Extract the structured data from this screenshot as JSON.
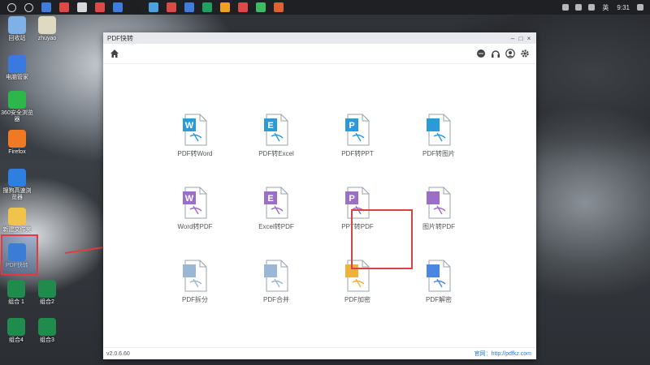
{
  "taskbar": {
    "time": "9:31",
    "ime": "英",
    "icons": [
      "search-icon",
      "task-view-icon",
      "browser-icon",
      "app-icon",
      "app-icon",
      "app-icon",
      "app-icon",
      "app-icon",
      "app-icon",
      "app-icon",
      "app-icon",
      "app-icon",
      "app-icon",
      "app-icon",
      "app-icon",
      "app-icon"
    ]
  },
  "desktop": {
    "icons": [
      {
        "label": "回收站",
        "color": "#7fb0e6"
      },
      {
        "label": "zhuyao",
        "color": "#e0d9c1"
      },
      {
        "label": "电脑管家",
        "color": "#3a7ae0"
      },
      {
        "label": "360安全浏览器",
        "color": "#2db64a"
      },
      {
        "label": "Firefox",
        "color": "#f07a24"
      },
      {
        "label": "搜狗高速浏览器",
        "color": "#2f7fe0"
      },
      {
        "label": "新建文件夹",
        "color": "#f0c34b"
      },
      {
        "label": "PDF快转",
        "color": "#3b86e8"
      },
      {
        "label": "组合 1",
        "color": "#1f8b4c"
      },
      {
        "label": "组合2",
        "color": "#1f8b4c"
      },
      {
        "label": "组合4",
        "color": "#1f8b4c"
      },
      {
        "label": "组合3",
        "color": "#1f8b4c"
      }
    ]
  },
  "window": {
    "title": "PDF快转",
    "controls": [
      "–",
      "□",
      "×"
    ],
    "version": "v2.0.6.60",
    "site": "官网：http://pdfkz.com",
    "tiles": [
      {
        "label": "PDF转Word",
        "letter": "W",
        "color": "#2c9ad8"
      },
      {
        "label": "PDF转Excel",
        "letter": "E",
        "color": "#2c9ad8"
      },
      {
        "label": "PDF转PPT",
        "letter": "P",
        "color": "#2c9ad8"
      },
      {
        "label": "PDF转图片",
        "letter": "▲",
        "color": "#2c9ad8"
      },
      {
        "label": "Word转PDF",
        "letter": "W",
        "color": "#9b6fc7"
      },
      {
        "label": "Excel转PDF",
        "letter": "E",
        "color": "#9b6fc7"
      },
      {
        "label": "PPT转PDF",
        "letter": "P",
        "color": "#9b6fc7"
      },
      {
        "label": "图片转PDF",
        "letter": "▲",
        "color": "#9b6fc7"
      },
      {
        "label": "PDF拆分",
        "letter": "",
        "color": "#9bb7d6"
      },
      {
        "label": "PDF合并",
        "letter": "",
        "color": "#9bb7d6"
      },
      {
        "label": "PDF加密",
        "letter": "🔒",
        "color": "#f0b03c"
      },
      {
        "label": "PDF解密",
        "letter": "🔓",
        "color": "#4a87e0"
      }
    ]
  }
}
